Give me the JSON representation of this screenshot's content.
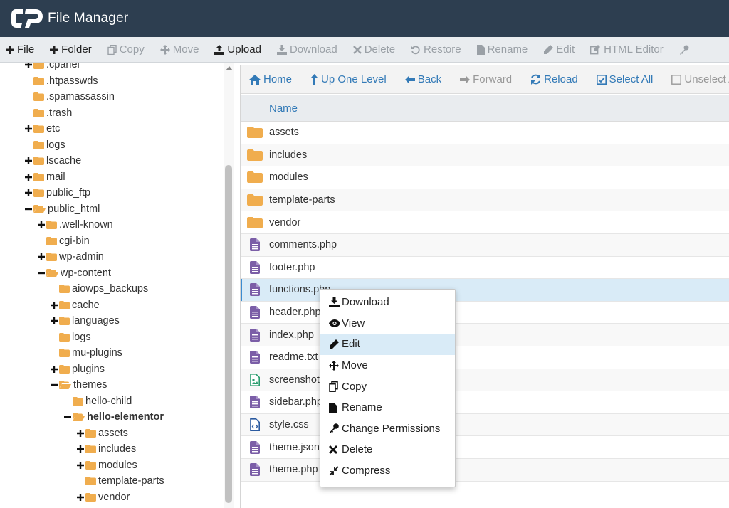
{
  "header": {
    "title": "File Manager"
  },
  "toolbar": {
    "file": "File",
    "folder": "Folder",
    "copy": "Copy",
    "move": "Move",
    "upload": "Upload",
    "download": "Download",
    "delete": "Delete",
    "restore": "Restore",
    "rename": "Rename",
    "edit": "Edit",
    "html_editor": "HTML Editor"
  },
  "tree": {
    "items": [
      ".cpanel",
      ".htpasswds",
      ".spamassassin",
      ".trash",
      "etc",
      "logs",
      "lscache",
      "mail",
      "public_ftp",
      "public_html",
      ".well-known",
      "cgi-bin",
      "wp-admin",
      "wp-content",
      "aiowps_backups",
      "cache",
      "languages",
      "logs",
      "mu-plugins",
      "plugins",
      "themes",
      "hello-child",
      "hello-elementor",
      "assets",
      "includes",
      "modules",
      "template-parts",
      "vendor"
    ]
  },
  "nav": {
    "home": "Home",
    "up_one_level": "Up One Level",
    "back": "Back",
    "forward": "Forward",
    "reload": "Reload",
    "select_all": "Select All",
    "unselect_all": "Unselect All"
  },
  "list": {
    "column_name": "Name",
    "files": [
      "assets",
      "includes",
      "modules",
      "template-parts",
      "vendor",
      "comments.php",
      "footer.php",
      "functions.php",
      "header.php",
      "index.php",
      "readme.txt",
      "screenshot.png",
      "sidebar.php",
      "style.css",
      "theme.json",
      "theme.php"
    ]
  },
  "context_menu": {
    "items": [
      "Download",
      "View",
      "Edit",
      "Move",
      "Copy",
      "Rename",
      "Change Permissions",
      "Delete",
      "Compress"
    ]
  },
  "colors": {
    "header_bg": "#2d3e50",
    "link_blue": "#337ab7",
    "folder_orange": "#f0ad4e",
    "php_purple": "#7b5ea7",
    "selected_row": "#d9ebf7"
  }
}
